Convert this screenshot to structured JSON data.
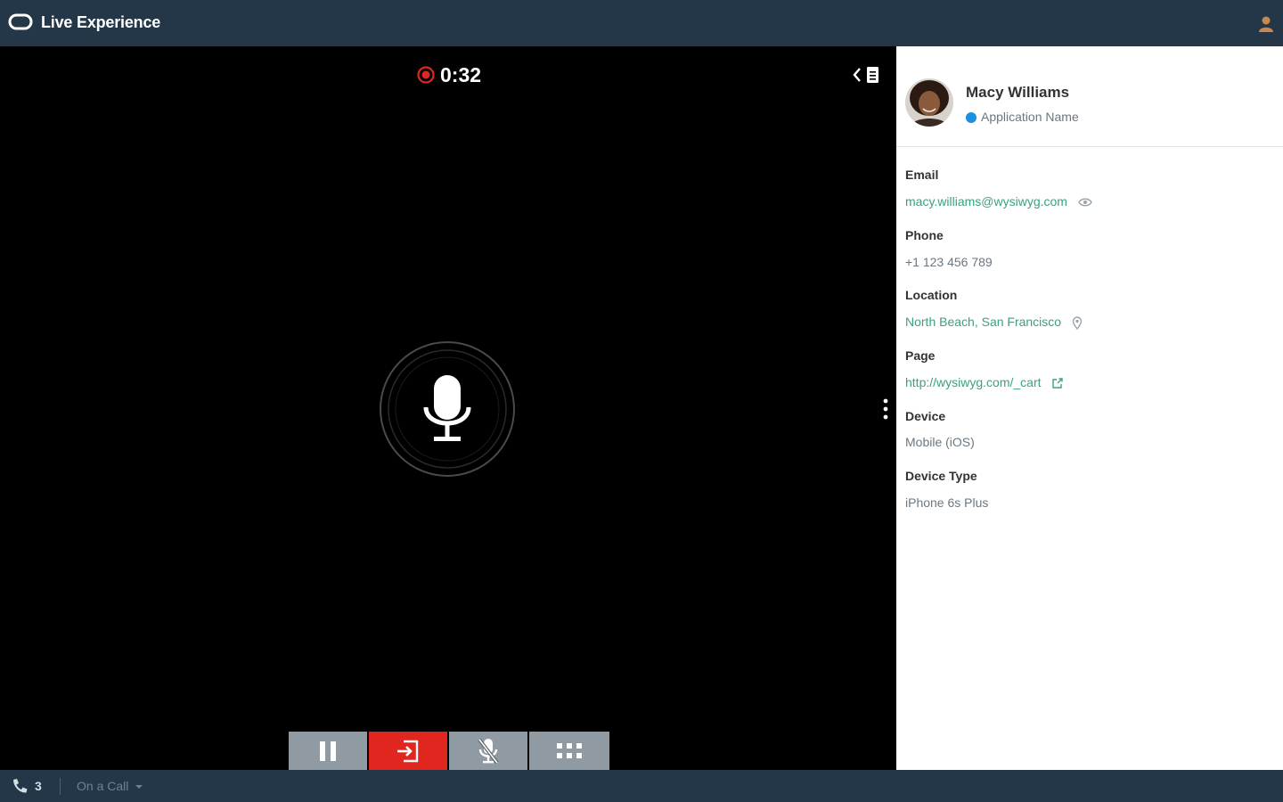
{
  "header": {
    "app_title": "Live Experience",
    "logo_icon": "oracle-ring-icon",
    "user_icon": "user-avatar-icon"
  },
  "call": {
    "recording_icon": "record-icon",
    "elapsed": "0:32",
    "panel_toggle_icon": "collapse-panel-icon",
    "center_icon": "microphone-icon",
    "more_icon": "kebab-menu-icon"
  },
  "controls": [
    {
      "name": "pause",
      "icon": "pause-icon",
      "color": "#8f9aa2"
    },
    {
      "name": "end-call",
      "icon": "exit-icon",
      "color": "#e0261f"
    },
    {
      "name": "mute",
      "icon": "microphone-muted-icon",
      "color": "#8f9aa2"
    },
    {
      "name": "keypad",
      "icon": "keypad-icon",
      "color": "#8f9aa2"
    }
  ],
  "customer": {
    "name": "Macy Williams",
    "app_name": "Application Name",
    "status_color": "#1a90e0",
    "fields": {
      "email": {
        "label": "Email",
        "value": "macy.williams@wysiwyg.com",
        "icon": "eye-icon"
      },
      "phone": {
        "label": "Phone",
        "value": "+1 123 456 789"
      },
      "location": {
        "label": "Location",
        "value": "North Beach, San Francisco",
        "icon": "map-pin-icon"
      },
      "page": {
        "label": "Page",
        "value": "http://wysiwyg.com/_cart",
        "icon": "external-link-icon"
      },
      "device": {
        "label": "Device",
        "value": "Mobile (iOS)"
      },
      "device_type": {
        "label": "Device Type",
        "value": "iPhone 6s Plus"
      }
    }
  },
  "statusbar": {
    "call_count": "3",
    "status": "On a Call",
    "phone_icon": "phone-icon",
    "dropdown_icon": "caret-down-icon"
  },
  "colors": {
    "header_bg": "#233748",
    "link": "#3aa27a",
    "record": "#e0261f"
  }
}
